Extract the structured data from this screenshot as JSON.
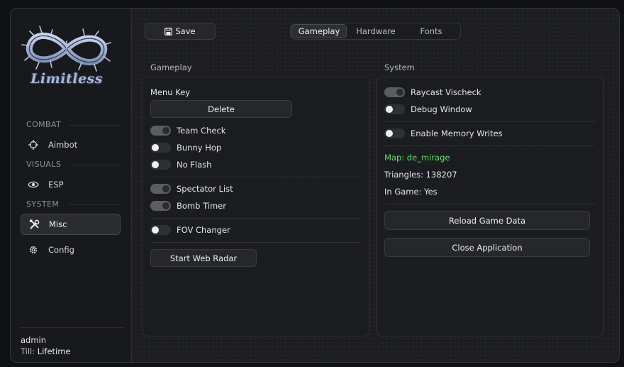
{
  "app": {
    "logo_text": "Limitless"
  },
  "sidebar": {
    "sections": [
      {
        "title": "COMBAT",
        "items": [
          {
            "label": "Aimbot",
            "icon": "crosshair-icon"
          }
        ]
      },
      {
        "title": "VISUALS",
        "items": [
          {
            "label": "ESP",
            "icon": "eye-icon"
          }
        ]
      },
      {
        "title": "SYSTEM",
        "items": [
          {
            "label": "Misc",
            "icon": "tools-icon",
            "active": true
          },
          {
            "label": "Config",
            "icon": "gear-icon"
          }
        ]
      }
    ],
    "user": {
      "name": "admin",
      "till_label": "Till:",
      "till_value": "Lifetime"
    }
  },
  "toolbar": {
    "save_label": "Save"
  },
  "tabs": [
    {
      "label": "Gameplay",
      "active": true
    },
    {
      "label": "Hardware"
    },
    {
      "label": "Fonts"
    }
  ],
  "gameplay": {
    "title": "Gameplay",
    "menu_key_label": "Menu Key",
    "menu_key_value": "Delete",
    "toggles": [
      {
        "label": "Team Check",
        "on": true
      },
      {
        "label": "Bunny Hop",
        "on": false
      },
      {
        "label": "No Flash",
        "on": false
      },
      {
        "label": "Spectator List",
        "on": true
      },
      {
        "label": "Bomb Timer",
        "on": true
      },
      {
        "label": "FOV Changer",
        "on": false
      }
    ],
    "web_radar_label": "Start Web Radar"
  },
  "system": {
    "title": "System",
    "toggles": [
      {
        "label": "Raycast Vischeck",
        "on": true
      },
      {
        "label": "Debug Window",
        "on": false
      },
      {
        "label": "Enable Memory Writes",
        "on": false
      }
    ],
    "map_text": "Map: de_mirage",
    "triangles_text": "Triangles: 138207",
    "in_game_text": "In Game: Yes",
    "reload_label": "Reload Game Data",
    "close_label": "Close Application"
  },
  "colors": {
    "accent_green": "#5ee06a",
    "background": "#1c1d21",
    "toggle_on": "#5b5d63"
  }
}
